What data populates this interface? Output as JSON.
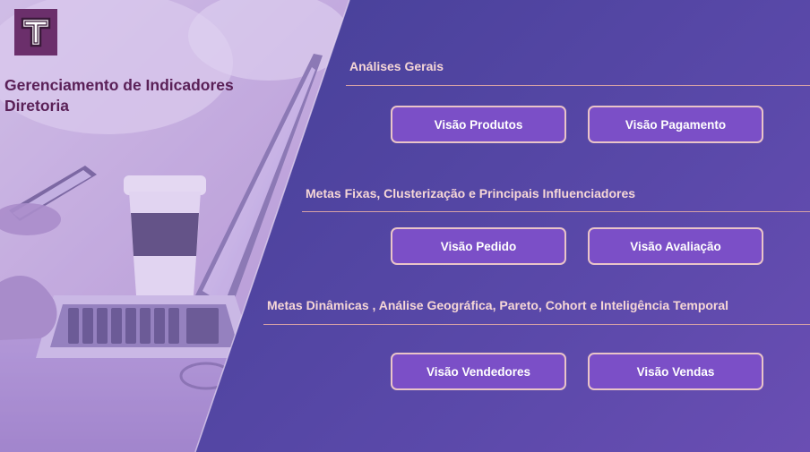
{
  "header": {
    "logo_letter": "T",
    "title_line1": "Gerenciamento de Indicadores",
    "title_line2": "Diretoria"
  },
  "sections": [
    {
      "title": "Análises Gerais",
      "buttons": [
        "Visão Produtos",
        "Visão Pagamento"
      ]
    },
    {
      "title": "Metas Fixas, Clusterização e Principais Influenciadores",
      "buttons": [
        "Visão Pedido",
        "Visão Avaliação"
      ]
    },
    {
      "title": "Metas Dinâmicas , Análise Geográfica, Pareto, Cohort e Inteligência Temporal",
      "buttons": [
        "Visão Vendedores",
        "Visão Vendas"
      ]
    }
  ],
  "colors": {
    "panel": "#5747a0",
    "button_fill": "#7b4fc7",
    "button_border": "#e9c4c8",
    "section_text": "#f6d7d6",
    "title_text": "#5a2057",
    "logo_bg": "#6b2f6b"
  },
  "icons": {
    "logo": "letter-t-logo-icon",
    "photo": "laptop-coffee-phone-photo"
  }
}
